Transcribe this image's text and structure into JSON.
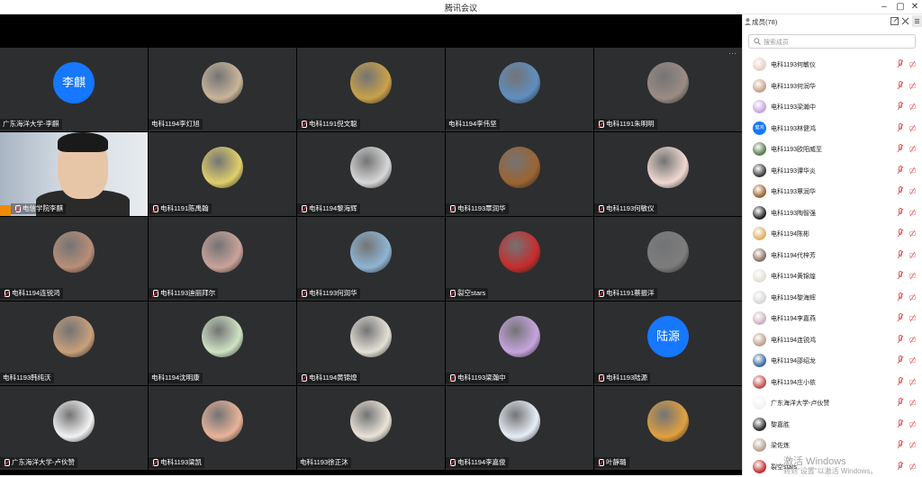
{
  "app": {
    "title": "腾讯会议"
  },
  "window": {
    "minimize": "–",
    "restore": "▢",
    "close": "✕"
  },
  "video": {
    "more_label": "···",
    "tiles": [
      {
        "name": "广东海洋大学-李麒",
        "avatar_text": "李麒",
        "mic": false,
        "color": "#1677ff"
      },
      {
        "name": "电科1194李灯旭",
        "mic": false,
        "color": "#c9b59a"
      },
      {
        "name": "电科1191倪文聪",
        "mic": true,
        "color": "#c9a14a"
      },
      {
        "name": "电科1194李伟坚",
        "mic": false,
        "color": "#5f8ec0"
      },
      {
        "name": "电科1191朱明明",
        "mic": true,
        "color": "#9a8c84"
      },
      {
        "name": "电信学院李麒",
        "mic": true,
        "webcam": true,
        "presenter": true
      },
      {
        "name": "电科1191陈禹翰",
        "mic": true,
        "color": "#e0cf6a"
      },
      {
        "name": "电科1194黎海辉",
        "mic": true,
        "color": "#d8d8d8"
      },
      {
        "name": "电科1193覃润华",
        "mic": true,
        "color": "#9c6431"
      },
      {
        "name": "电科1193何敏仪",
        "mic": true,
        "color": "#f0d8d0"
      },
      {
        "name": "电科1194连锐鸿",
        "mic": true,
        "color": "#b98e76"
      },
      {
        "name": "电科1193迪丽拜尔",
        "mic": true,
        "color": "#caa39a"
      },
      {
        "name": "电科1193何润华",
        "mic": true,
        "color": "#8fb5d3"
      },
      {
        "name": "裂空stars",
        "mic": true,
        "color": "#c62c2c"
      },
      {
        "name": "电科1191蔡振洋",
        "mic": true,
        "color": "#7d7d7d"
      },
      {
        "name": "电科1193韩纯沃",
        "mic": false,
        "color": "#c8a07a"
      },
      {
        "name": "电科1194沈明康",
        "mic": false,
        "color": "#cfe3c3"
      },
      {
        "name": "电科1194黄锦煌",
        "mic": true,
        "color": "#e4e0d6"
      },
      {
        "name": "电科1193梁瀚中",
        "mic": true,
        "color": "#c7a4e0"
      },
      {
        "name": "电科1193陆源",
        "avatar_text": "陆源",
        "mic": true,
        "color": "#1677ff"
      },
      {
        "name": "广东海洋大学-卢伙赞",
        "mic": true,
        "color": "#f3f3f3"
      },
      {
        "name": "电科1193梁凯",
        "mic": true,
        "color": "#e9b39a"
      },
      {
        "name": "电科1193徐正沐",
        "mic": false,
        "color": "#eae4d8"
      },
      {
        "name": "电科1194李嘉俊",
        "mic": true,
        "color": "#e7eef5"
      },
      {
        "name": "叶靜璐",
        "mic": true,
        "color": "#e0a040"
      }
    ]
  },
  "members_panel": {
    "title": "成员(78)",
    "search_placeholder": "搜索成员",
    "members": [
      {
        "name": "电科1193何敏仪",
        "color": "#e6cfc4"
      },
      {
        "name": "电科1193何润华",
        "color": "#c8a089"
      },
      {
        "name": "电科1193梁瀚中",
        "color": "#c7a4e0"
      },
      {
        "name": "电科1193林健鸿",
        "avatar_text": "健鸿",
        "color": "#1677ff"
      },
      {
        "name": "电科1193欧阳威至",
        "color": "#5a7a50"
      },
      {
        "name": "电科1193谭华炎",
        "color": "#3a3a3a"
      },
      {
        "name": "电科1193覃润华",
        "color": "#9c6431"
      },
      {
        "name": "电科1193陶智强",
        "color": "#222222"
      },
      {
        "name": "电科1194陈彬",
        "color": "#e0b060"
      },
      {
        "name": "电科1194代梓芳",
        "color": "#8a7060"
      },
      {
        "name": "电科1194黄锦煌",
        "color": "#e4e0d6"
      },
      {
        "name": "电科1194黎海辉",
        "color": "#d8d8d8"
      },
      {
        "name": "电科1194李嘉燕",
        "color": "#d0b0c0"
      },
      {
        "name": "电科1194连锐鸿",
        "color": "#c0a090"
      },
      {
        "name": "电科1194邵绍龙",
        "color": "#3a6aa0"
      },
      {
        "name": "电科1194庄小依",
        "color": "#c0504a"
      },
      {
        "name": "广东海洋大学-卢伙赞",
        "color": "#f3f3f3"
      },
      {
        "name": "黎嘉胜",
        "color": "#2a2a2a"
      },
      {
        "name": "梁佐炼",
        "color": "#b8a090"
      },
      {
        "name": "裂空stars",
        "color": "#c62c2c"
      }
    ]
  },
  "watermark": {
    "line1": "激活 Windows",
    "line2": "转到\"设置\"以激活 Windows。"
  }
}
